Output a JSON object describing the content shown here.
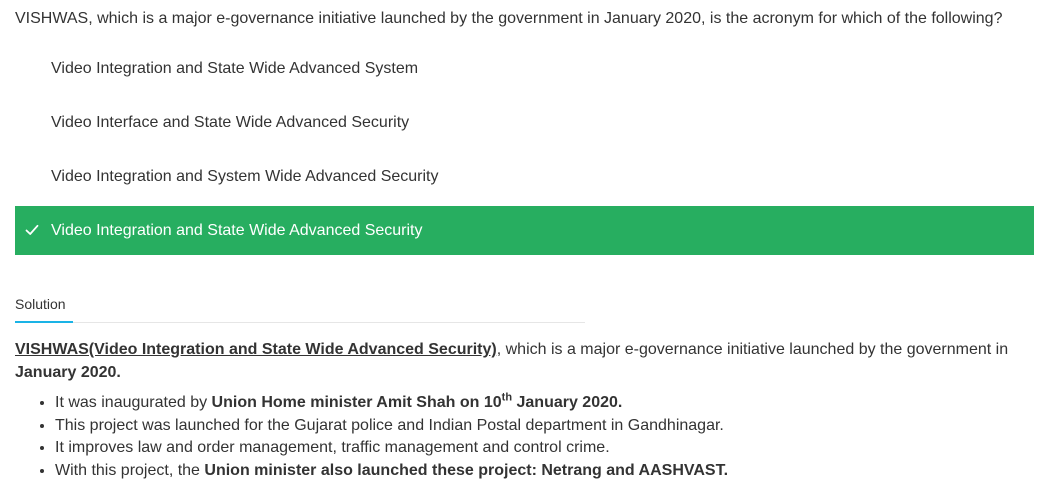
{
  "question": {
    "text": "VISHWAS, which is a major e-governance initiative launched by the government in January 2020, is the acronym for which of the following?"
  },
  "options": [
    {
      "label": "Video Integration and State Wide Advanced System",
      "correct": false
    },
    {
      "label": "Video Interface and State Wide Advanced Security",
      "correct": false
    },
    {
      "label": "Video Integration and System Wide Advanced Security",
      "correct": false
    },
    {
      "label": "Video Integration and State Wide Advanced Security",
      "correct": true
    }
  ],
  "colors": {
    "correct_bg": "#27ae60",
    "tab_underline": "#1ab3e6",
    "text": "#333333"
  },
  "solution": {
    "tab_label": "Solution",
    "intro_bold": "VISHWAS(Video Integration and State Wide Advanced Security)",
    "intro_rest": ", which is a major e-governance initiative launched by the government in",
    "intro_date": "January 2020.",
    "points": {
      "p1_pre": "It was inaugurated by ",
      "p1_bold": "Union Home minister Amit Shah on 10",
      "p1_sup": "th",
      "p1_bold2": " January 2020.",
      "p2": "This project was launched for the Gujarat police and Indian Postal department in Gandhinagar.",
      "p3": "It improves law and order management, traffic management and control crime.",
      "p4_pre": "With this project, the ",
      "p4_bold": "Union minister also launched these project: Netrang and AASHVAST."
    }
  }
}
